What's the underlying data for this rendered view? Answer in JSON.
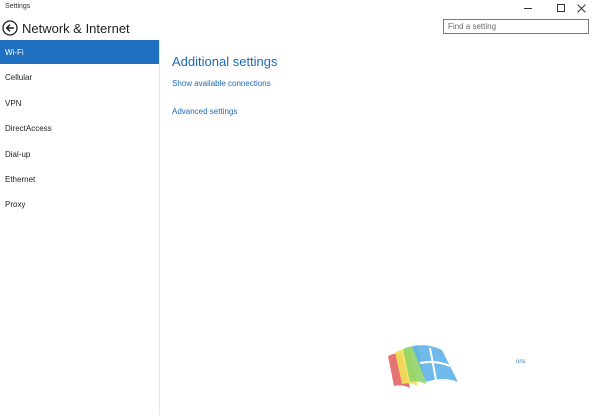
{
  "window": {
    "title": "Settings"
  },
  "header": {
    "title": "Network & Internet",
    "search_placeholder": "Find a setting"
  },
  "sidebar": {
    "items": [
      {
        "label": "Wi-Fi",
        "selected": true
      },
      {
        "label": "Cellular",
        "selected": false
      },
      {
        "label": "VPN",
        "selected": false
      },
      {
        "label": "DirectAccess",
        "selected": false
      },
      {
        "label": "Dial-up",
        "selected": false
      },
      {
        "label": "Ethernet",
        "selected": false
      },
      {
        "label": "Proxy",
        "selected": false
      }
    ]
  },
  "main": {
    "section_title": "Additional settings",
    "links": [
      {
        "label": "Show available connections"
      },
      {
        "label": "Advanced settings"
      }
    ]
  },
  "watermark": {
    "text": "ons"
  },
  "colors": {
    "accent": "#1e6fc0",
    "link": "#1a6aba"
  }
}
